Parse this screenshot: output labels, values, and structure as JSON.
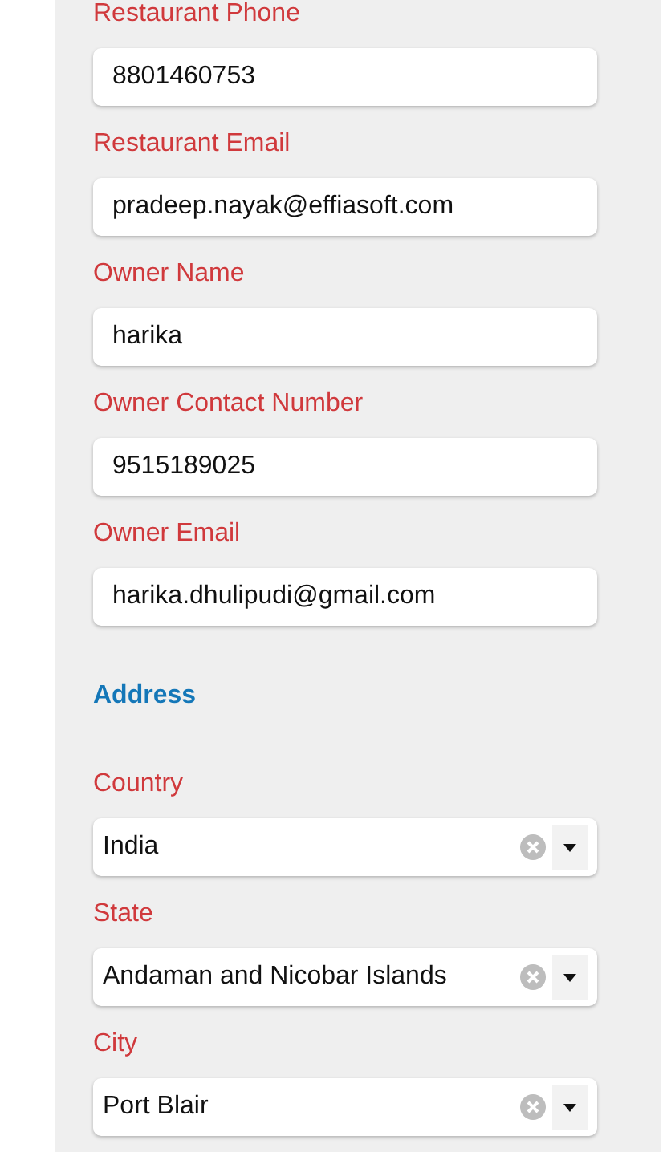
{
  "contact_fields": [
    {
      "label": "Restaurant Phone",
      "value": "8801460753"
    },
    {
      "label": "Restaurant Email",
      "value": "pradeep.nayak@effiasoft.com"
    },
    {
      "label": "Owner Name",
      "value": "harika"
    },
    {
      "label": "Owner Contact Number",
      "value": "9515189025"
    },
    {
      "label": "Owner Email",
      "value": "harika.dhulipudi@gmail.com"
    }
  ],
  "address": {
    "heading": "Address",
    "fields": [
      {
        "label": "Country",
        "value": "India"
      },
      {
        "label": "State",
        "value": "Andaman and Nicobar Islands"
      },
      {
        "label": "City",
        "value": "Port Blair"
      }
    ]
  }
}
